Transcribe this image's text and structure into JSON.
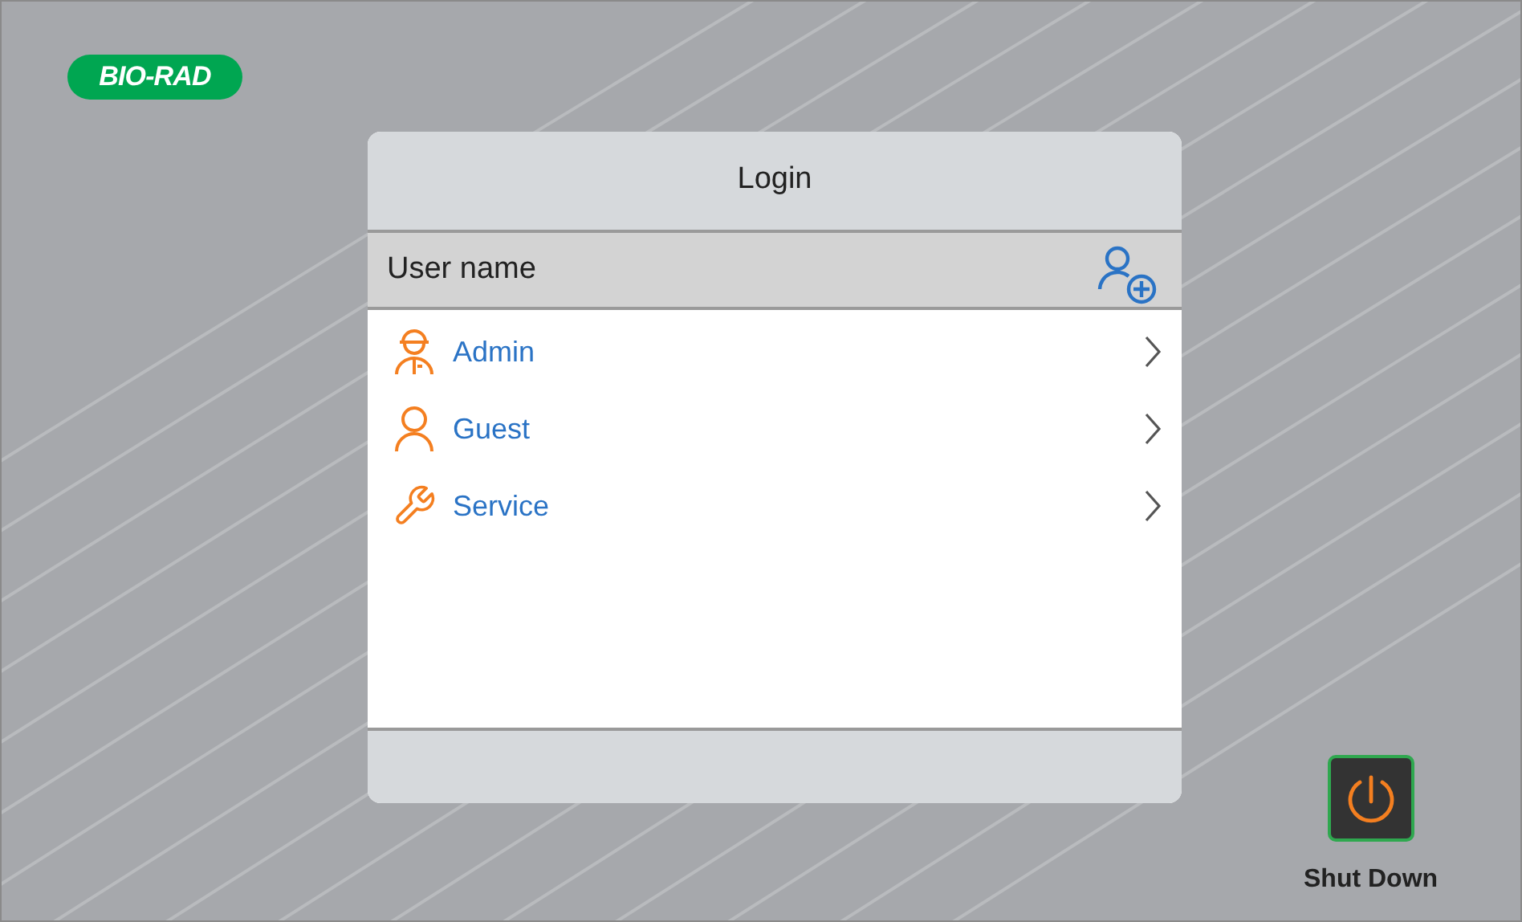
{
  "logo": {
    "text": "BIO-RAD"
  },
  "dialog": {
    "title": "Login",
    "header": {
      "label": "User name"
    },
    "users": [
      {
        "name": "Admin",
        "kind": "admin"
      },
      {
        "name": "Guest",
        "kind": "guest"
      },
      {
        "name": "Service",
        "kind": "service"
      }
    ]
  },
  "shutdown": {
    "label": "Shut Down"
  }
}
